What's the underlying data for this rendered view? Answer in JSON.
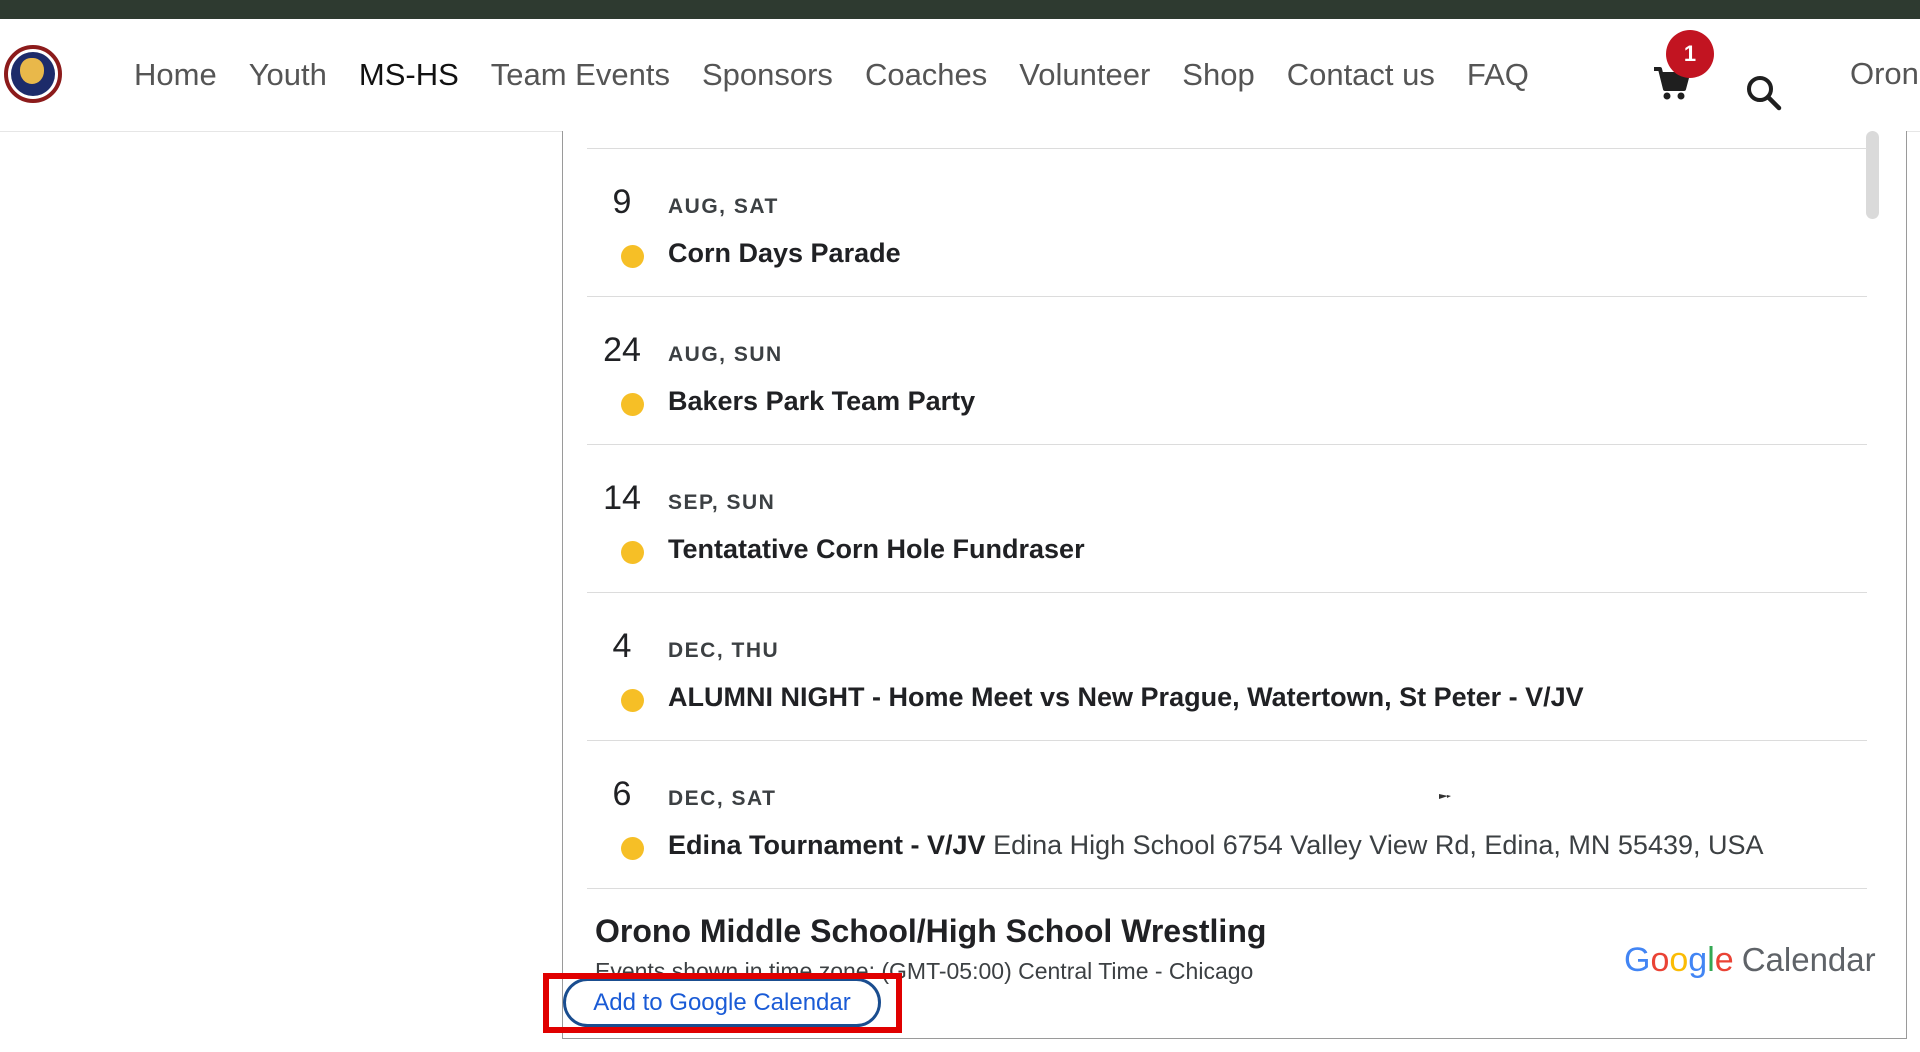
{
  "header": {
    "nav": [
      "Home",
      "Youth",
      "MS-HS",
      "Team Events",
      "Sponsors",
      "Coaches",
      "Volunteer",
      "Shop",
      "Contact us",
      "FAQ"
    ],
    "active_nav": "MS-HS",
    "cart_count": "1",
    "brand_partial": "Orono"
  },
  "calendar": {
    "events": [
      {
        "day": "9",
        "month_weekday": "AUG, SAT",
        "title": "Corn Days Parade",
        "location": ""
      },
      {
        "day": "24",
        "month_weekday": "AUG, SUN",
        "title": "Bakers Park Team Party",
        "location": ""
      },
      {
        "day": "14",
        "month_weekday": "SEP, SUN",
        "title": "Tentatative Corn Hole Fundraser",
        "location": ""
      },
      {
        "day": "4",
        "month_weekday": "DEC, THU",
        "title": "ALUMNI NIGHT - Home Meet vs New Prague, Watertown, St Peter - V/JV",
        "location": ""
      },
      {
        "day": "6",
        "month_weekday": "DEC, SAT",
        "title": "Edina Tournament - V/JV",
        "location": "Edina High School 6754 Valley View Rd, Edina, MN 55439, USA"
      }
    ],
    "calendar_name": "Orono Middle School/High School Wrestling",
    "timezone_text": "Events shown in time zone: (GMT-05:00) Central Time - Chicago",
    "google_logo": {
      "letters": [
        "G",
        "o",
        "o",
        "g",
        "l",
        "e"
      ],
      "word": "Calendar"
    },
    "add_button": "Add to Google Calendar"
  },
  "colors": {
    "event_dot": "#f6bf26",
    "highlight": "#e00000",
    "badge": "#c21421",
    "top_strip": "#2e3a30"
  }
}
